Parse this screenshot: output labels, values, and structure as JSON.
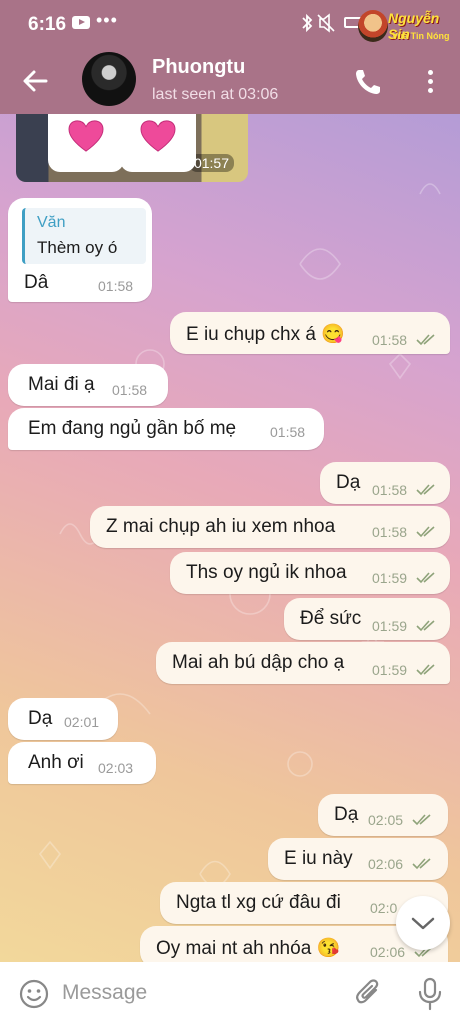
{
  "status_bar": {
    "time": "6:16",
    "dots": "•••"
  },
  "logo": {
    "name": "Nguyễn Sin",
    "subtitle": "Vua Tin Nóng"
  },
  "header": {
    "contact_name": "Phuongtu",
    "last_seen": "last seen at 03:06"
  },
  "photo": {
    "time": "01:57"
  },
  "reply_message": {
    "quote_author": "Văn",
    "quote_text": "Thèm oy ó",
    "text": "Dâ",
    "time": "01:58"
  },
  "messages": [
    {
      "direction": "out",
      "text": "E iu chụp chx á 😋",
      "time": "01:58"
    },
    {
      "direction": "in",
      "text": "Mai đi ạ",
      "time": "01:58"
    },
    {
      "direction": "in",
      "text": "Em đang ngủ gần bố mẹ",
      "time": "01:58"
    },
    {
      "direction": "out",
      "text": "Dạ",
      "time": "01:58"
    },
    {
      "direction": "out",
      "text": "Z mai chụp ah iu xem nhoa",
      "time": "01:58"
    },
    {
      "direction": "out",
      "text": "Ths oy ngủ ik nhoa",
      "time": "01:59"
    },
    {
      "direction": "out",
      "text": "Để sức",
      "time": "01:59"
    },
    {
      "direction": "out",
      "text": "Mai ah bú dập cho ạ",
      "time": "01:59"
    },
    {
      "direction": "in",
      "text": "Dạ",
      "time": "02:01"
    },
    {
      "direction": "in",
      "text": "Anh ơi",
      "time": "02:03"
    },
    {
      "direction": "out",
      "text": "Dạ",
      "time": "02:05"
    },
    {
      "direction": "out",
      "text": "E iu này",
      "time": "02:06"
    },
    {
      "direction": "out",
      "text": "Ngta tl xg cứ đâu đi",
      "time": "02:0"
    },
    {
      "direction": "out",
      "text": "Oy mai nt ah nhóa 😘",
      "time": "02:06"
    }
  ],
  "input": {
    "placeholder": "Message"
  },
  "colors": {
    "header": "#a97388",
    "incoming_bubble": "#ffffff",
    "outgoing_bubble": "#fdf6ec",
    "tick": "#8fa37a",
    "reply_accent": "#3f9fc4"
  }
}
